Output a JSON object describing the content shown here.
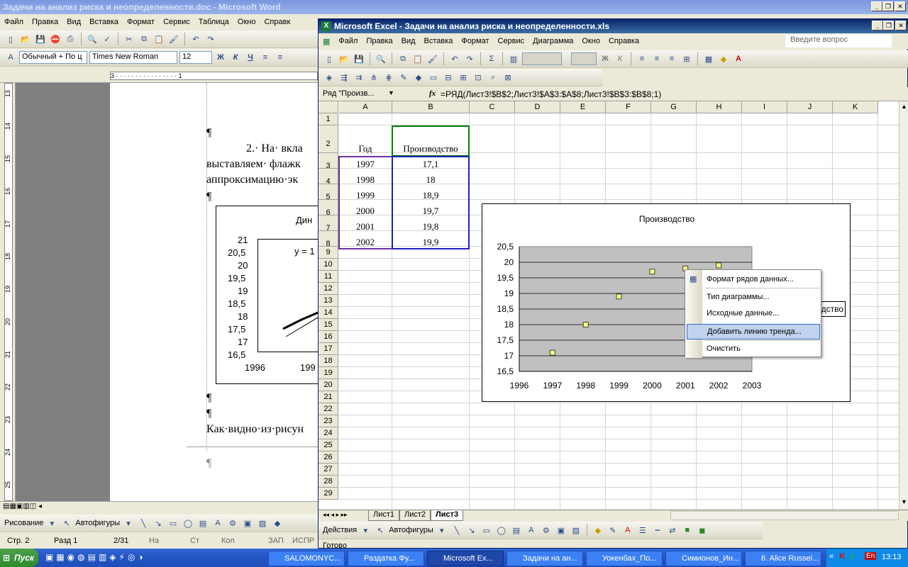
{
  "word": {
    "title": "Задачи на анализ риска и неопределенности.doc - Microsoft Word",
    "menu": [
      "Файл",
      "Правка",
      "Вид",
      "Вставка",
      "Формат",
      "Сервис",
      "Таблица",
      "Окно",
      "Справк"
    ],
    "style_combo": "Обычный + По ц",
    "font_combo": "Times New Roman",
    "size_combo": "12",
    "paragraph_marks": [
      "¶",
      "¶",
      "¶",
      "¶",
      "¶",
      "¶"
    ],
    "para1": "2.· На· вкла",
    "para2": "выставляем· флажк",
    "para3": "аппроксимацию·эк",
    "para4": "Как·видно·из·рисун",
    "embedded_chart": {
      "title_fragment": "Дин",
      "equation_fragment": "y = 1",
      "y_ticks": [
        "21",
        "20,5",
        "20",
        "19,5",
        "19",
        "18,5",
        "18",
        "17,5",
        "17",
        "16,5"
      ],
      "x_ticks": [
        "1996",
        "199"
      ]
    },
    "ruler_numbers": [
      "13",
      "14",
      "15",
      "16",
      "17",
      "18",
      "19",
      "20",
      "21",
      "22",
      "23",
      "24",
      "25"
    ],
    "ruler_top": "3 · · · · · · · · · · · · · · · · 1",
    "status": {
      "page": "Стр. 2",
      "section": "Разд 1",
      "pages": "2/31",
      "at": "На",
      "line": "Ст",
      "col": "Кол",
      "rec": "ЗАП",
      "trk": "ИСПР"
    },
    "drawing_label": "Рисование",
    "autoshapes_label": "Автофигуры"
  },
  "excel": {
    "title": "Microsoft Excel - Задачи на анализ риска и неопределенности.xls",
    "menu": [
      "Файл",
      "Правка",
      "Вид",
      "Вставка",
      "Формат",
      "Сервис",
      "Диаграмма",
      "Окно",
      "Справка"
    ],
    "help_placeholder": "Введите вопрос",
    "name_box": "Ряд \"Произв...",
    "fx": "fx",
    "formula": "=РЯД(Лист3!$B$2;Лист3!$A$3:$A$8;Лист3!$B$3:$B$8;1)",
    "columns": [
      "A",
      "B",
      "C",
      "D",
      "E",
      "F",
      "G",
      "H",
      "I",
      "J",
      "K"
    ],
    "rows": [
      "1",
      "2",
      "3",
      "4",
      "5",
      "6",
      "7",
      "8",
      "9",
      "10",
      "11",
      "12",
      "13",
      "14",
      "15",
      "16",
      "17",
      "18",
      "19",
      "20",
      "21",
      "22",
      "23",
      "24",
      "25",
      "26",
      "27",
      "28",
      "29"
    ],
    "table": {
      "headers": [
        "Год",
        "Производство"
      ],
      "data": [
        [
          "1997",
          "17,1"
        ],
        [
          "1998",
          "18"
        ],
        [
          "1999",
          "18,9"
        ],
        [
          "2000",
          "19,7"
        ],
        [
          "2001",
          "19,8"
        ],
        [
          "2002",
          "19,9"
        ]
      ]
    },
    "sheet_tabs": [
      "Лист1",
      "Лист2",
      "Лист3"
    ],
    "drawing": {
      "actions": "Действия",
      "autoshapes": "Автофигуры"
    },
    "status_fragment": "Готово",
    "legend_fragment": "дство",
    "context_menu": [
      {
        "label": "Формат рядов данных...",
        "icon": "format-icon"
      },
      {
        "label": "Тип диаграммы...",
        "icon": ""
      },
      {
        "label": "Исходные данные...",
        "icon": ""
      },
      {
        "label": "Добавить линию тренда...",
        "icon": "",
        "highlighted": true
      },
      {
        "label": "Очистить",
        "icon": ""
      }
    ]
  },
  "chart_data": {
    "type": "scatter",
    "title": "Производство",
    "x": [
      1997,
      1998,
      1999,
      2000,
      2001,
      2002
    ],
    "y": [
      17.1,
      18,
      18.9,
      19.7,
      19.8,
      19.9
    ],
    "xlim": [
      1996,
      2003
    ],
    "ylim": [
      16.5,
      20.5
    ],
    "x_ticks": [
      "1996",
      "1997",
      "1998",
      "1999",
      "2000",
      "2001",
      "2002",
      "2003"
    ],
    "y_ticks": [
      "20,5",
      "20",
      "19,5",
      "19",
      "18,5",
      "18",
      "17,5",
      "17",
      "16,5"
    ],
    "plot_bg": "#c0c0c0",
    "marker_color": "#ffff80",
    "grid": true
  },
  "taskbar": {
    "start": "Пуск",
    "buttons": [
      "SALOMONYC...",
      "Раздатка Фу...",
      "Microsoft Ex...",
      "Задачи на ан...",
      "Уокенбах_По...",
      "Симионов_Ин...",
      "6. Alice Russel..."
    ],
    "lang": "En",
    "clock": "13:13"
  }
}
